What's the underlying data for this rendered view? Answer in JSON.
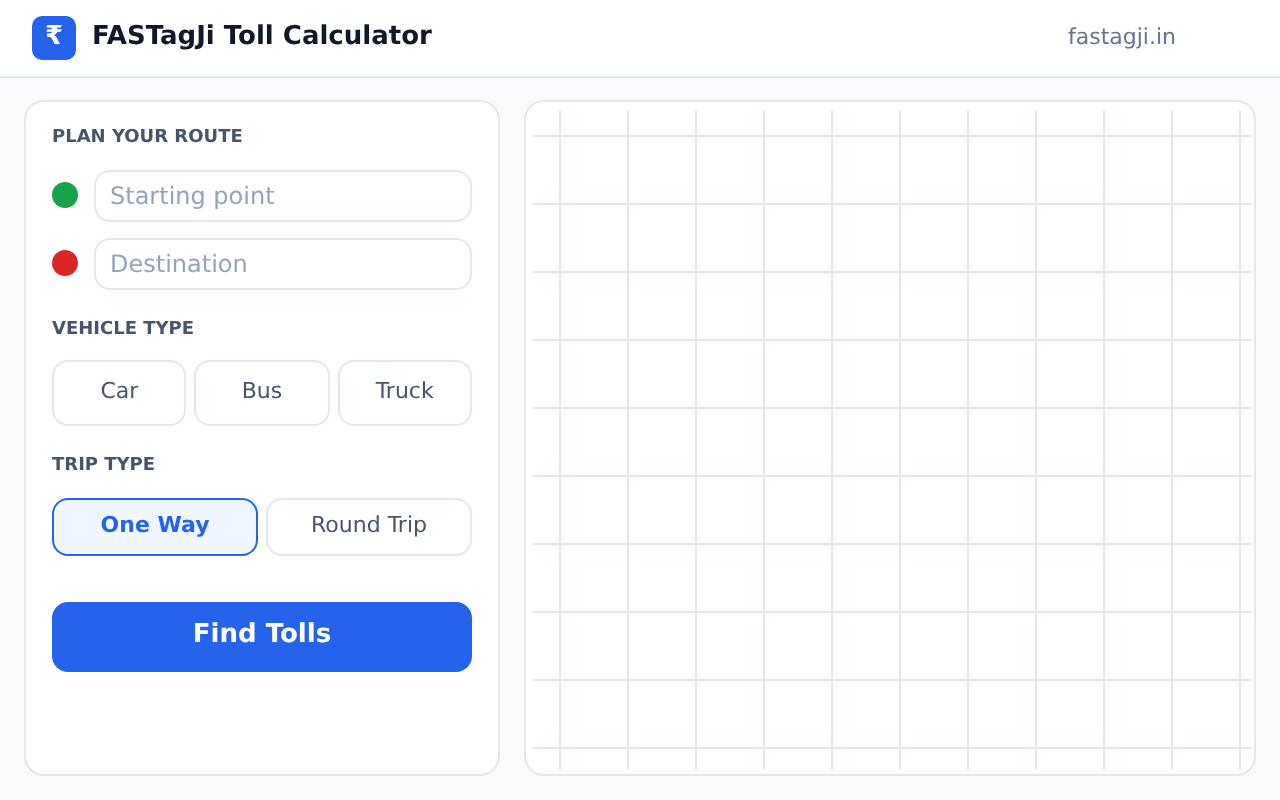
{
  "header": {
    "logo_symbol": "₹",
    "title": "FASTagJi Toll Calculator",
    "site": "fastagji.in"
  },
  "route": {
    "heading": "PLAN YOUR ROUTE",
    "fields": [
      {
        "placeholder": "Starting point",
        "color": "#16a34a"
      },
      {
        "placeholder": "Destination",
        "color": "#dc2626"
      }
    ]
  },
  "vehicle": {
    "heading": "VEHICLE TYPE",
    "options": [
      {
        "label": "Car",
        "selected": false
      },
      {
        "label": "Bus",
        "selected": false
      },
      {
        "label": "Truck",
        "selected": false
      }
    ]
  },
  "trip": {
    "heading": "TRIP TYPE",
    "options": [
      {
        "label": "One Way",
        "selected": true
      },
      {
        "label": "Round Trip",
        "selected": false
      }
    ]
  },
  "action": "Find Tolls"
}
